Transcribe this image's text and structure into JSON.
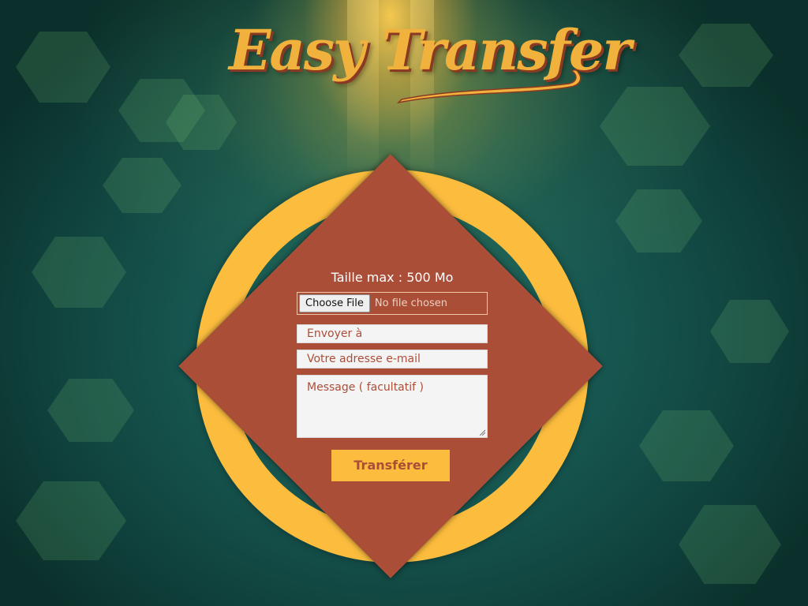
{
  "logo": {
    "text": "Easy Transfer"
  },
  "form": {
    "size_label": "Taille max : 500 Mo",
    "file_button_label": "Choose File",
    "file_status": "No file chosen",
    "recipient_placeholder": "Envoyer à",
    "sender_placeholder": "Votre adresse e-mail",
    "message_placeholder": "Message ( facultatif )",
    "submit_label": "Transférer"
  },
  "colors": {
    "ring": "#fcbd3e",
    "diamond": "#ab4e38",
    "background": "#175650",
    "logo": "#f0b23c"
  },
  "icons": {
    "resize_grip": "resize-grip-icon"
  }
}
